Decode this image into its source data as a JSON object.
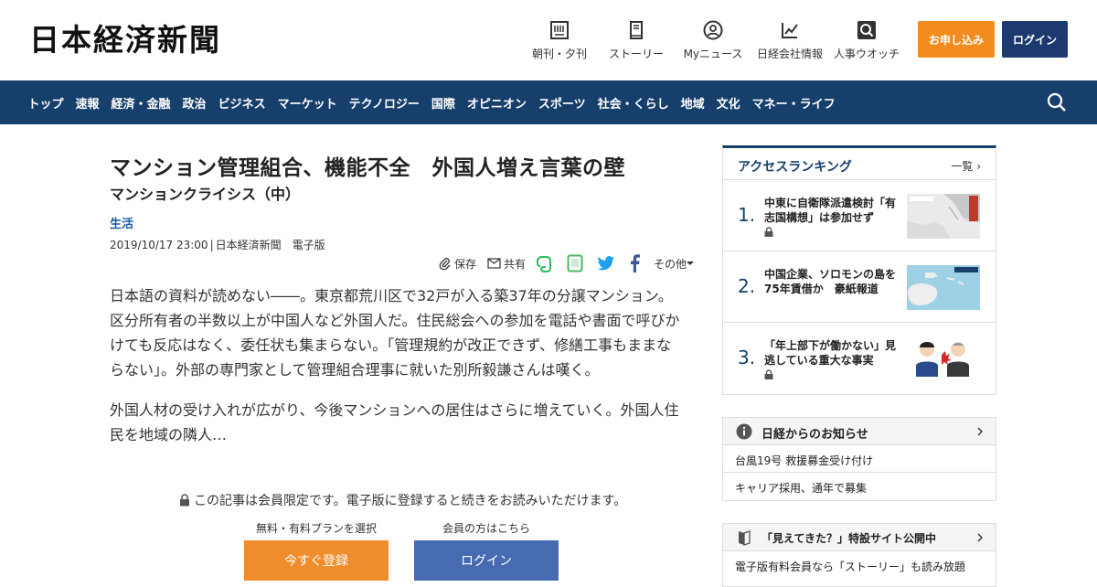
{
  "header": {
    "logo": "日本経済新聞",
    "nav": [
      {
        "label": "朝刊・夕刊",
        "icon": "newspaper-icon"
      },
      {
        "label": "ストーリー",
        "icon": "book-icon"
      },
      {
        "label": "Myニュース",
        "icon": "user-icon"
      },
      {
        "label": "日経会社情報",
        "icon": "chart-icon"
      },
      {
        "label": "人事ウオッチ",
        "icon": "search-person-icon"
      }
    ],
    "apply_label": "お申し込み",
    "login_label": "ログイン"
  },
  "navbar": {
    "items": [
      "トップ",
      "速報",
      "経済・金融",
      "政治",
      "ビジネス",
      "マーケット",
      "テクノロジー",
      "国際",
      "オピニオン",
      "スポーツ",
      "社会・くらし",
      "地域",
      "文化",
      "マネー・ライフ"
    ]
  },
  "article": {
    "title": "マンション管理組合、機能不全　外国人増え言葉の壁",
    "subtitle": "マンションクライシス（中）",
    "category": "生活",
    "date": "2019/10/17 23:00",
    "source": "日本経済新聞　電子版",
    "tools": {
      "save": "保存",
      "share": "共有",
      "more": "その他"
    },
    "paragraphs": [
      "日本語の資料が読めない――。東京都荒川区で32戸が入る築37年の分譲マンション。区分所有者の半数以上が中国人など外国人だ。住民総会への参加を電話や書面で呼びかけても反応はなく、委任状も集まらない。「管理規約が改正できず、修繕工事もままならない」。外部の専門家として管理組合理事に就いた別所毅謙さんは嘆く。",
      "外国人材の受け入れが広がり、今後マンションへの居住はさらに増えていく。外国人住民を地域の隣人…"
    ],
    "locked_note": "この記事は会員限定です。電子版に登録すると続きをお読みいただけます。",
    "cta": {
      "plan_label": "無料・有料プランを選択",
      "member_label": "会員の方はこちら",
      "register_button": "今すぐ登録",
      "login_button": "ログイン"
    }
  },
  "ranking": {
    "title": "アクセスランキング",
    "more": "一覧",
    "items": [
      {
        "rank": "1.",
        "text": "中東に自衛隊派遣検討「有志国構想」は参加せず"
      },
      {
        "rank": "2.",
        "text": "中国企業、ソロモンの島を75年賃借か　豪紙報道"
      },
      {
        "rank": "3.",
        "text": "「年上部下が働かない」見逃している重大な事実"
      }
    ]
  },
  "notice": {
    "title": "日経からのお知らせ",
    "items": [
      "台風19号 救援募金受け付け",
      "キャリア採用、通年で募集"
    ]
  },
  "special": {
    "title": "「見えてきた？」特設サイト公開中",
    "item": "電子版有料会員なら「ストーリー」も読み放題"
  },
  "colors": {
    "navy": "#173f6c",
    "orange": "#f28c1e",
    "link": "#1a5aa8",
    "login_blue": "#466bb0"
  }
}
